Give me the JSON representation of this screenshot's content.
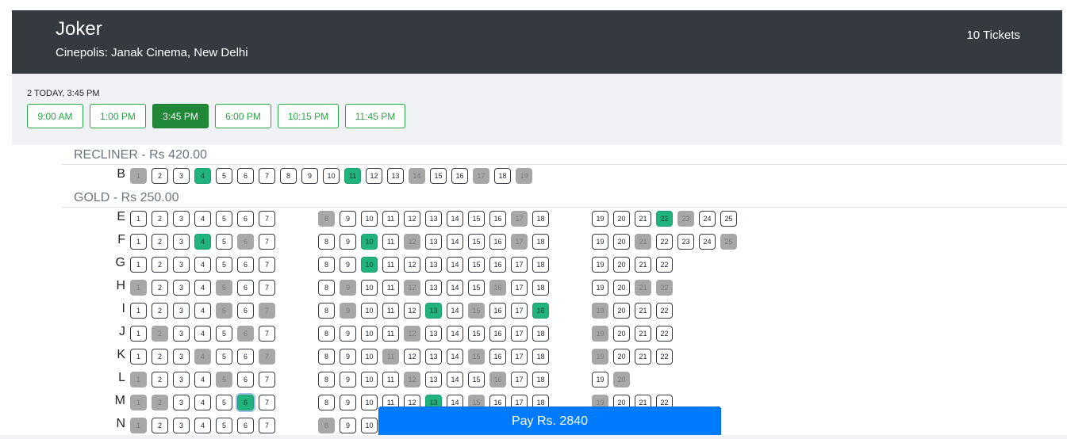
{
  "header": {
    "title": "Joker",
    "venue": "Cinepolis: Janak Cinema, New Delhi",
    "tickets": "10 Tickets"
  },
  "showtime": {
    "selected_label": "2 TODAY, 3:45 PM",
    "times": [
      "9:00 AM",
      "1:00 PM",
      "3:45 PM",
      "6:00 PM",
      "10:15 PM",
      "11:45 PM"
    ],
    "active_index": 2
  },
  "sections": [
    {
      "label": "RECLINER - Rs 420.00",
      "rows": [
        {
          "letter": "B",
          "blocks": [
            [
              1,
              19
            ]
          ],
          "unavailable": [
            1,
            14,
            17,
            19
          ],
          "selected": [
            4,
            11
          ]
        }
      ]
    },
    {
      "label": "GOLD - Rs 250.00",
      "rows": [
        {
          "letter": "E",
          "blocks": [
            [
              1,
              7
            ],
            [
              8,
              18
            ],
            [
              19,
              25
            ]
          ],
          "unavailable": [
            8,
            17,
            23
          ],
          "selected": [
            22
          ]
        },
        {
          "letter": "F",
          "blocks": [
            [
              1,
              7
            ],
            [
              8,
              18
            ],
            [
              19,
              25
            ]
          ],
          "unavailable": [
            6,
            12,
            17,
            21,
            25
          ],
          "selected": [
            4,
            10
          ]
        },
        {
          "letter": "G",
          "blocks": [
            [
              1,
              7
            ],
            [
              8,
              18
            ],
            [
              19,
              22
            ]
          ],
          "unavailable": [],
          "selected": [
            10
          ]
        },
        {
          "letter": "H",
          "blocks": [
            [
              1,
              7
            ],
            [
              8,
              18
            ],
            [
              19,
              22
            ]
          ],
          "unavailable": [
            1,
            5,
            9,
            12,
            16,
            21,
            22
          ],
          "selected": []
        },
        {
          "letter": "I",
          "blocks": [
            [
              1,
              7
            ],
            [
              8,
              18
            ],
            [
              19,
              22
            ]
          ],
          "unavailable": [
            5,
            7,
            9,
            15,
            19
          ],
          "selected": [
            13,
            18
          ]
        },
        {
          "letter": "J",
          "blocks": [
            [
              1,
              7
            ],
            [
              8,
              18
            ],
            [
              19,
              22
            ]
          ],
          "unavailable": [
            2,
            6,
            12,
            19
          ],
          "selected": []
        },
        {
          "letter": "K",
          "blocks": [
            [
              1,
              7
            ],
            [
              8,
              18
            ],
            [
              19,
              22
            ]
          ],
          "unavailable": [
            4,
            7,
            11,
            15,
            19
          ],
          "selected": []
        },
        {
          "letter": "L",
          "blocks": [
            [
              1,
              7
            ],
            [
              8,
              18
            ],
            [
              19,
              20
            ]
          ],
          "unavailable": [
            1,
            5,
            12,
            16,
            20
          ],
          "selected": []
        },
        {
          "letter": "M",
          "blocks": [
            [
              1,
              7
            ],
            [
              8,
              18
            ],
            [
              19,
              22
            ]
          ],
          "unavailable": [
            1,
            2,
            15,
            19
          ],
          "selected": [
            6,
            13
          ],
          "focused": [
            6
          ]
        },
        {
          "letter": "N",
          "blocks": [
            [
              1,
              7
            ],
            [
              8,
              10
            ]
          ],
          "unavailable": [
            1,
            8
          ],
          "selected": []
        }
      ]
    }
  ],
  "pay": {
    "label": "Pay Rs. 2840"
  }
}
